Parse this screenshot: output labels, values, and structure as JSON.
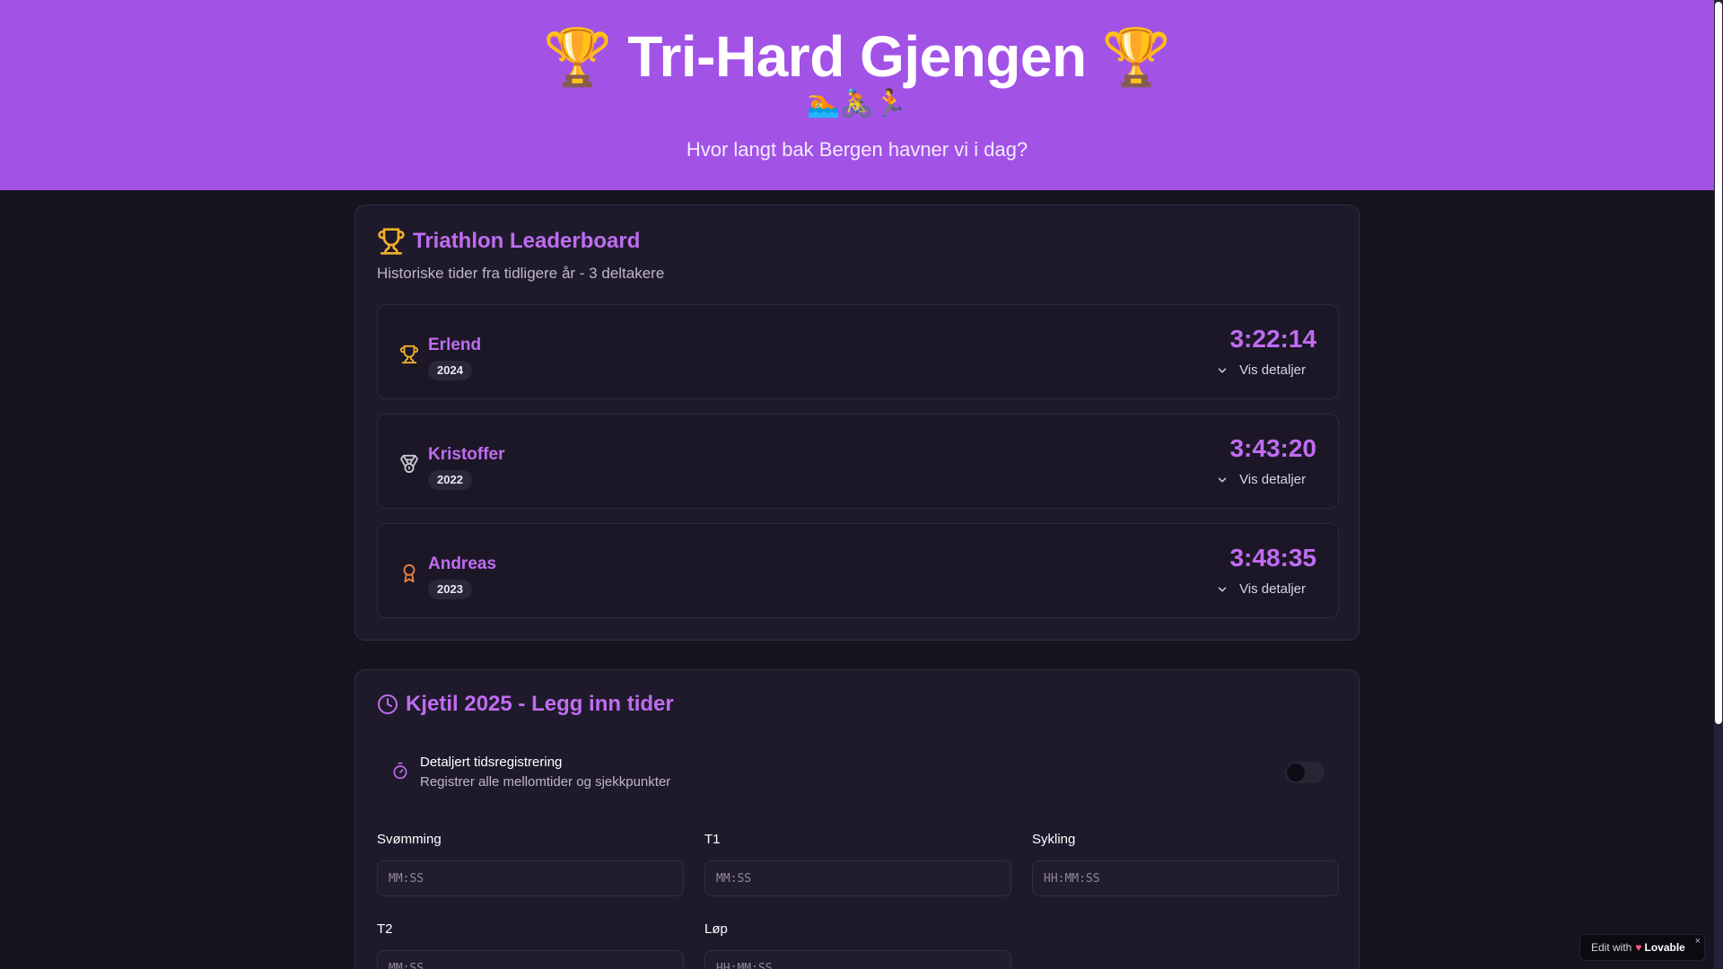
{
  "hero": {
    "title": "Tri-Hard Gjengen",
    "trophy_left": "🏆",
    "trophy_right": "🏆",
    "sports": "🏊🚴🏃",
    "subtitle": "Hvor langt bak Bergen havner vi i dag?"
  },
  "leaderboard": {
    "title": "Triathlon Leaderboard",
    "subtitle": "Historiske tider fra tidligere år - 3 deltakere",
    "details_label": "Vis detaljer",
    "entries": [
      {
        "name": "Erlend",
        "year": "2024",
        "time": "3:22:14",
        "icon": "trophy-icon"
      },
      {
        "name": "Kristoffer",
        "year": "2022",
        "time": "3:43:20",
        "icon": "medal-icon"
      },
      {
        "name": "Andreas",
        "year": "2023",
        "time": "3:48:35",
        "icon": "award-icon"
      }
    ]
  },
  "kjetil": {
    "title": "Kjetil 2025 - Legg inn tider",
    "toggle_title": "Detaljert tidsregistrering",
    "toggle_desc": "Registrer alle mellomtider og sjekkpunkter",
    "toggle_on": false,
    "fields": {
      "swim": {
        "label": "Svømming",
        "placeholder": "MM:SS"
      },
      "t1": {
        "label": "T1",
        "placeholder": "MM:SS"
      },
      "bike": {
        "label": "Sykling",
        "placeholder": "HH:MM:SS"
      },
      "t2": {
        "label": "T2",
        "placeholder": "MM:SS"
      },
      "run": {
        "label": "Løp",
        "placeholder": "HH:MM:SS"
      }
    }
  },
  "lovable": {
    "edit_with": "Edit with",
    "brand": "Lovable",
    "close": "×"
  },
  "colors": {
    "accent": "#c06cf1",
    "hero_bg": "#a253e6",
    "page_bg": "#17131f",
    "gold": "#f2b22b",
    "silver": "#c8c8d0",
    "bronze": "#e8853a"
  }
}
